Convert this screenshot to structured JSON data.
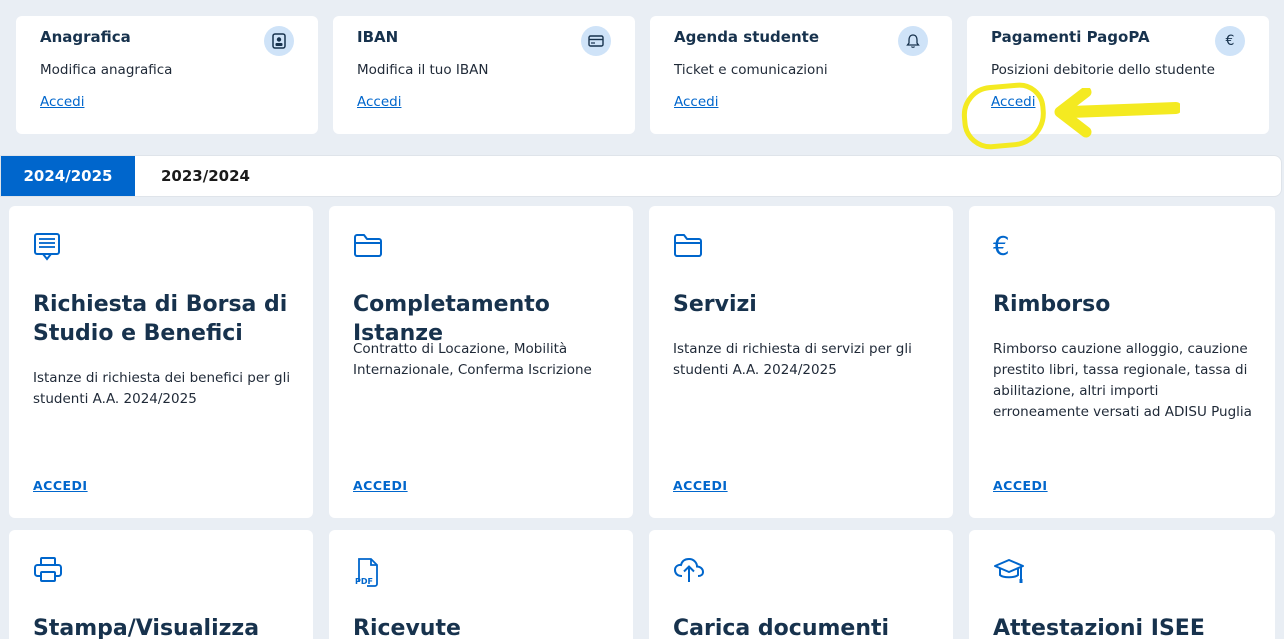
{
  "quick_cards": [
    {
      "title": "Anagrafica",
      "desc": "Modifica anagrafica",
      "link": "Accedi",
      "icon": "id-card-icon"
    },
    {
      "title": "IBAN",
      "desc": "Modifica il tuo IBAN",
      "link": "Accedi",
      "icon": "credit-card-icon"
    },
    {
      "title": "Agenda studente",
      "desc": "Ticket e comunicazioni",
      "link": "Accedi",
      "icon": "bell-icon"
    },
    {
      "title": "Pagamenti PagoPA",
      "desc": "Posizioni debitorie dello studente",
      "link": "Accedi",
      "icon": "euro-icon",
      "euro_glyph": "€"
    }
  ],
  "tabs": [
    {
      "label": "2024/2025",
      "active": true
    },
    {
      "label": "2023/2024",
      "active": false
    }
  ],
  "cards": [
    {
      "title": "Richiesta di Borsa di Studio e Benefici",
      "desc": "Istanze di richiesta dei benefici per gli studenti A.A. 2024/2025",
      "action": "ACCEDI",
      "icon": "document-list-icon"
    },
    {
      "title": "Completamento Istanze",
      "desc": "Contratto di Locazione, Mobilità Internazionale, Conferma Iscrizione",
      "action": "ACCEDI",
      "icon": "folder-icon"
    },
    {
      "title": "Servizi",
      "desc": "Istanze di richiesta di servizi per gli studenti A.A. 2024/2025",
      "action": "ACCEDI",
      "icon": "folder-icon"
    },
    {
      "title": "Rimborso",
      "desc": "Rimborso cauzione alloggio, cauzione prestito libri, tassa regionale, tassa di abilitazione, altri importi erroneamente versati ad ADISU Puglia",
      "action": "ACCEDI",
      "icon": "euro-icon",
      "euro_glyph": "€"
    },
    {
      "title": "Stampa/Visualizza",
      "icon": "printer-icon"
    },
    {
      "title": "Ricevute",
      "icon": "pdf-file-icon",
      "pdf_text": "PDF"
    },
    {
      "title": "Carica documenti",
      "icon": "cloud-upload-icon"
    },
    {
      "title": "Attestazioni ISEE",
      "icon": "graduation-cap-icon"
    }
  ],
  "colors": {
    "accent": "#0066cc",
    "title": "#17324d",
    "highlight": "#f4ea21",
    "background": "#e9eef4"
  }
}
